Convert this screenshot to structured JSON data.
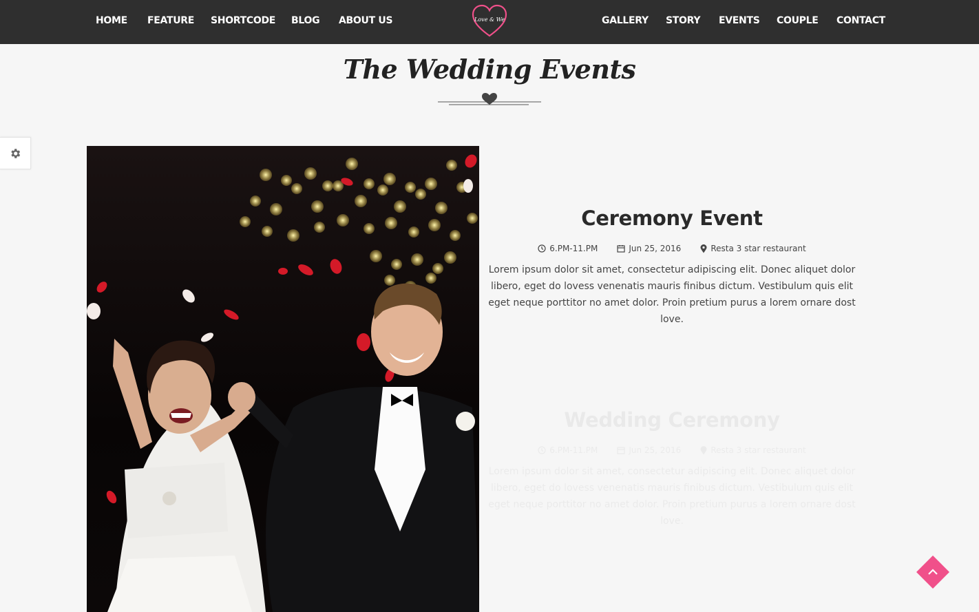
{
  "nav": {
    "left": [
      "HOME",
      "FEATURE",
      "SHORTCODE",
      "BLOG",
      "ABOUT US"
    ],
    "right": [
      "GALLERY",
      "STORY",
      "EVENTS",
      "COUPLE",
      "CONTACT"
    ],
    "logo_text": "Love & We"
  },
  "section": {
    "title": "The Wedding Events"
  },
  "events": [
    {
      "title": "Ceremony Event",
      "time": "6.PM-11.PM",
      "date": "Jun 25, 2016",
      "location": "Resta 3 star restaurant",
      "description": "Lorem ipsum dolor sit amet, consectetur adipiscing elit. Donec aliquet dolor libero, eget do lovess venenatis mauris finibus dictum. Vestibulum quis elit eget neque porttitor no amet dolor. Proin pretium purus a lorem ornare dost love."
    },
    {
      "title": "Wedding Ceremony",
      "time": "6.PM-11.PM",
      "date": "Jun 25, 2016",
      "location": "Resta 3 star restaurant",
      "description": "Lorem ipsum dolor sit amet, consectetur adipiscing elit. Donec aliquet dolor libero, eget do lovess venenatis mauris finibus dictum. Vestibulum quis elit eget neque porttitor no amet dolor. Proin pretium purus a lorem ornare dost love."
    }
  ],
  "colors": {
    "nav_bg": "#2f2f2f",
    "accent": "#f0508a",
    "page_bg": "#f6f6f6"
  },
  "icons": [
    "clock-icon",
    "calendar-icon",
    "map-pin-icon",
    "gear-icon",
    "heart-icon",
    "chevron-up-icon"
  ]
}
